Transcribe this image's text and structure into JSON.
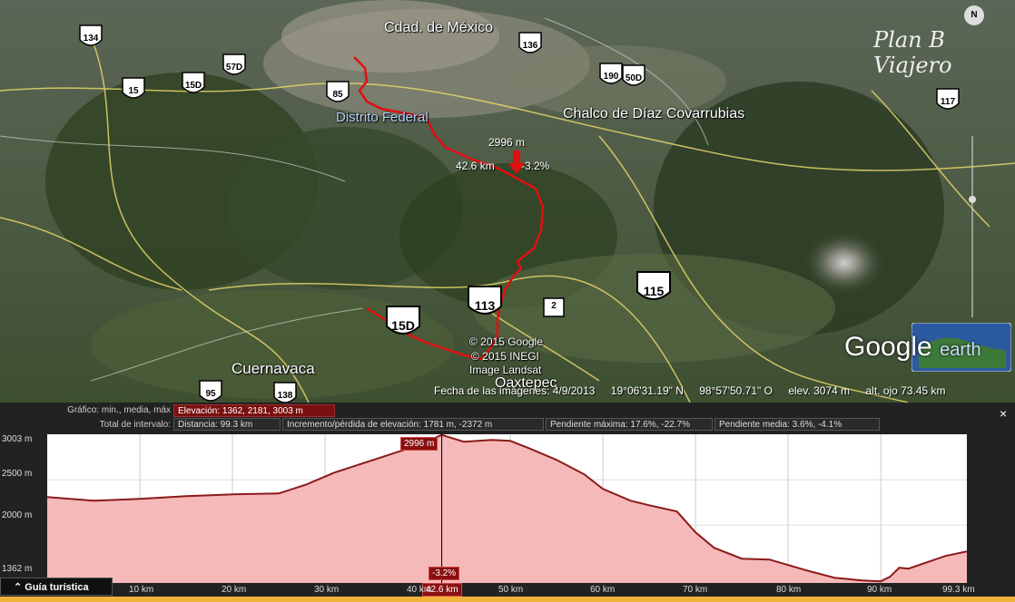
{
  "map": {
    "labels": {
      "cdmx": "Cdad. de México",
      "df": "Distrito Federal",
      "chalco": "Chalco de Díaz Covarrubias",
      "cuernavaca": "Cuernavaca",
      "oaxtepec": "Oaxtepec"
    },
    "shields": {
      "s134": "134",
      "s15": "15",
      "s15d_top": "15D",
      "s57d": "57D",
      "s85": "85",
      "s136": "136",
      "s190": "190",
      "s50d": "50D",
      "s117": "117",
      "s115": "115",
      "s113": "113",
      "s15d": "15D",
      "s95": "95",
      "s138": "138",
      "s2": "2"
    },
    "marker": {
      "elevation": "2996 m",
      "distance": "42.6 km",
      "grade": "-3.2%"
    },
    "attribution": [
      "© 2015 Google",
      "© 2015 INEGI",
      "Image Landsat"
    ],
    "watermark": "Plan B Viajero",
    "logo": {
      "google": "Google",
      "earth": "earth"
    },
    "compass": "N",
    "status": {
      "date": "Fecha de las imágenes: 4/9/2013",
      "lat": "19°06'31.19\" N",
      "lon": "98°57'50.71\" O",
      "elev": "elev.  3074 m",
      "eye": "alt. ojo  73.45 km"
    },
    "colors": {
      "route": "#e01010"
    }
  },
  "profile": {
    "labels": {
      "graph": "Gráfico: min., media, máx",
      "interval": "Total de intervalo:"
    },
    "stats": {
      "elevation": "Elevación: 1362, 2181, 3003 m",
      "distance": "Distancia: 99.3 km",
      "gain": "Incremento/pérdida de elevación: 1781 m, -2372 m",
      "max_slope": "Pendiente máxima: 17.6%, -22.7%",
      "avg_slope": "Pendiente media: 3.6%, -4.1%"
    },
    "close": "×",
    "guide": "Guía turística",
    "cursor": {
      "elevation": "2996 m",
      "grade": "-3.2%",
      "distance": "42.6 km"
    },
    "y_ticks": [
      "3003 m",
      "2500 m",
      "2000 m",
      "1362 m"
    ],
    "x_ticks": [
      "10 km",
      "20 km",
      "30 km",
      "40 km",
      "50 km",
      "60 km",
      "70 km",
      "80 km",
      "90 km",
      "99.3 km"
    ],
    "colors": {
      "line": "#8b1a1a",
      "fill": "#f6b9b9"
    }
  },
  "chart_data": {
    "type": "area",
    "xlabel": "",
    "ylabel": "",
    "ylim": [
      1362,
      3003
    ],
    "xlim": [
      0,
      99.3
    ],
    "x": [
      0,
      5,
      10,
      15,
      20,
      25,
      28,
      31,
      34,
      37,
      40,
      42.6,
      45,
      48,
      50,
      52,
      55,
      58,
      60,
      63,
      65,
      68,
      70,
      72,
      75,
      78,
      80,
      82,
      85,
      88,
      90,
      91,
      92,
      93,
      95,
      97,
      99.3
    ],
    "y": [
      2310,
      2270,
      2290,
      2320,
      2340,
      2350,
      2450,
      2580,
      2680,
      2780,
      2880,
      2996,
      2920,
      2940,
      2930,
      2850,
      2720,
      2560,
      2400,
      2270,
      2220,
      2150,
      1920,
      1750,
      1630,
      1620,
      1560,
      1500,
      1420,
      1390,
      1380,
      1430,
      1530,
      1520,
      1590,
      1660,
      1710
    ]
  }
}
